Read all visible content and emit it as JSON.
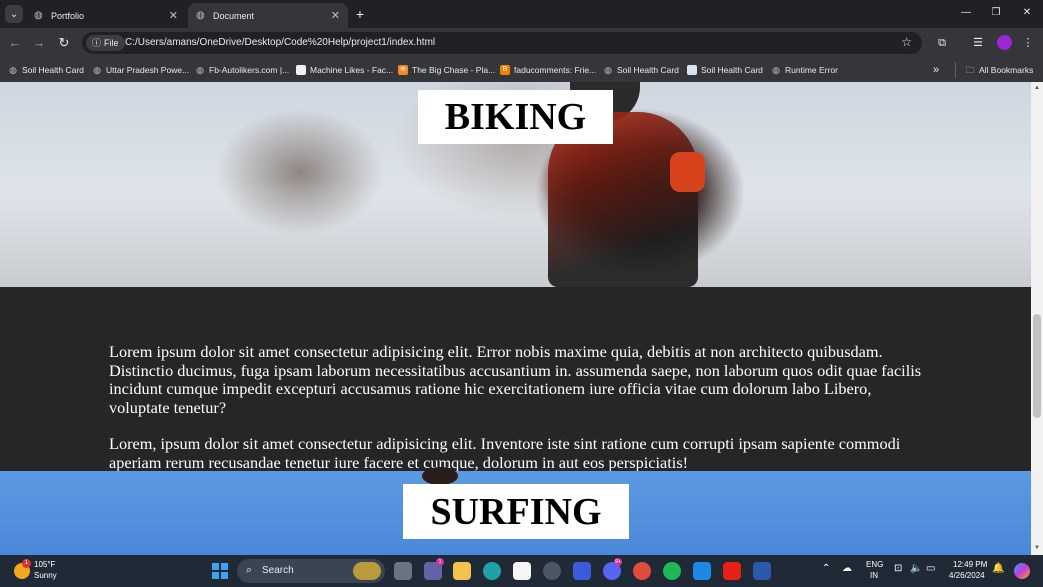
{
  "browser": {
    "tab_list_icon": "chevron-down-icon",
    "tabs": [
      {
        "title": "Portfolio",
        "active": false
      },
      {
        "title": "Document",
        "active": true
      }
    ],
    "new_tab_label": "+",
    "window_controls": {
      "minimize": "—",
      "restore": "❐",
      "close": "✕"
    },
    "toolbar": {
      "file_chip": "File",
      "url": "C:/Users/amans/OneDrive/Desktop/Code%20Help/project1/index.html"
    },
    "bookmarks": [
      {
        "label": "Soil Health Card",
        "icon": "globe-icon"
      },
      {
        "label": "Uttar Pradesh Powe...",
        "icon": "globe-icon"
      },
      {
        "label": "Fb-Autolikers.com |...",
        "icon": "globe-icon"
      },
      {
        "label": "Machine Likes - Fac...",
        "icon": "page-icon"
      },
      {
        "label": "The Big Chase - Pla...",
        "icon": "rss-icon"
      },
      {
        "label": "faducomments: Frie...",
        "icon": "blogger-icon"
      },
      {
        "label": "Soil Health Card",
        "icon": "globe-icon"
      },
      {
        "label": "Soil Health Card",
        "icon": "doc-icon"
      },
      {
        "label": "Runtime Error",
        "icon": "globe-icon"
      }
    ],
    "all_bookmarks": "All Bookmarks"
  },
  "page": {
    "hero1_title": "BIKING",
    "para1": "Lorem ipsum dolor sit amet consectetur adipisicing elit. Error nobis maxime quia, debitis at non architecto quibusdam. Distinctio ducimus, fuga ipsam laborum necessitatibus accusantium in. assumenda saepe, non laborum quos odit quae facilis incidunt cumque impedit excepturi accusamus ratione hic exercitationem iure officia vitae cum dolorum labo Libero, voluptate tenetur?",
    "para2": "Lorem, ipsum dolor sit amet consectetur adipisicing elit. Inventore iste sint ratione cum corrupti ipsam sapiente commodi aperiam rerum recusandae tenetur iure facere et cumque, dolorum in aut eos perspiciatis!",
    "hero2_title": "SURFING"
  },
  "taskbar": {
    "weather": {
      "temp": "105°F",
      "condition": "Sunny",
      "badge": "1"
    },
    "search_label": "Search",
    "apps": [
      {
        "name": "task-view-icon",
        "color": "#6b7280"
      },
      {
        "name": "teams-icon",
        "color": "#6264a7"
      },
      {
        "name": "file-explorer-icon",
        "color": "#f2c14e"
      },
      {
        "name": "edge-icon",
        "color": "#1fa1a8"
      },
      {
        "name": "store-icon",
        "color": "#f5f5f5"
      },
      {
        "name": "github-icon",
        "color": "#4b5563"
      },
      {
        "name": "app-icon",
        "color": "#3b5bdb"
      },
      {
        "name": "discord-icon",
        "color": "#5865f2"
      },
      {
        "name": "chrome-icon",
        "color": "#e04b3b"
      },
      {
        "name": "spotify-icon",
        "color": "#1db954"
      },
      {
        "name": "vscode-icon",
        "color": "#1a8ae6"
      },
      {
        "name": "youtube-icon",
        "color": "#e62117"
      },
      {
        "name": "word-icon",
        "color": "#2b5aa8"
      }
    ],
    "teams_badge": "1",
    "discord_badge": "9+",
    "language": "ENG",
    "region": "IN",
    "time": "12:49 PM",
    "date": "4/26/2024"
  }
}
